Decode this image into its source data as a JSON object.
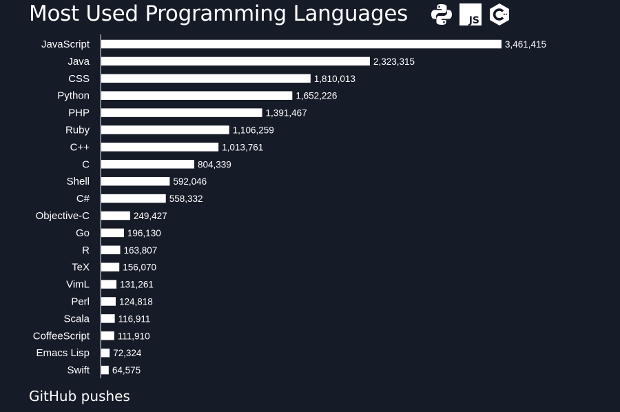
{
  "header": {
    "title": "Most Used Programming Languages",
    "icons": [
      "python-logo-icon",
      "javascript-logo-icon",
      "cpp-logo-icon"
    ],
    "js_icon_text": "JS"
  },
  "footer": {
    "caption": "GitHub pushes"
  },
  "colors": {
    "background": "#161b28",
    "bar": "#ffffff",
    "text": "#ffffff",
    "axis": "#9aa0aa"
  },
  "chart_data": {
    "type": "bar",
    "orientation": "horizontal",
    "title": "Most Used Programming Languages",
    "xlabel": "GitHub pushes",
    "ylabel": "",
    "grid": false,
    "legend": "none",
    "xlim": [
      0,
      3461415
    ],
    "categories": [
      "JavaScript",
      "Java",
      "CSS",
      "Python",
      "PHP",
      "Ruby",
      "C++",
      "C",
      "Shell",
      "C#",
      "Objective-C",
      "Go",
      "R",
      "TeX",
      "VimL",
      "Perl",
      "Scala",
      "CoffeeScript",
      "Emacs Lisp",
      "Swift"
    ],
    "values": [
      3461415,
      2323315,
      1810013,
      1652226,
      1391467,
      1106259,
      1013761,
      804339,
      592046,
      558332,
      249427,
      196130,
      163807,
      156070,
      131261,
      124818,
      116911,
      111910,
      72324,
      64575
    ],
    "value_labels": [
      "3,461,415",
      "2,323,315",
      "1,810,013",
      "1,652,226",
      "1,391,467",
      "1,106,259",
      "1,013,761",
      "804,339",
      "592,046",
      "558,332",
      "249,427",
      "196,130",
      "163,807",
      "156,070",
      "131,261",
      "124,818",
      "116,911",
      "111,910",
      "72,324",
      "64,575"
    ]
  }
}
